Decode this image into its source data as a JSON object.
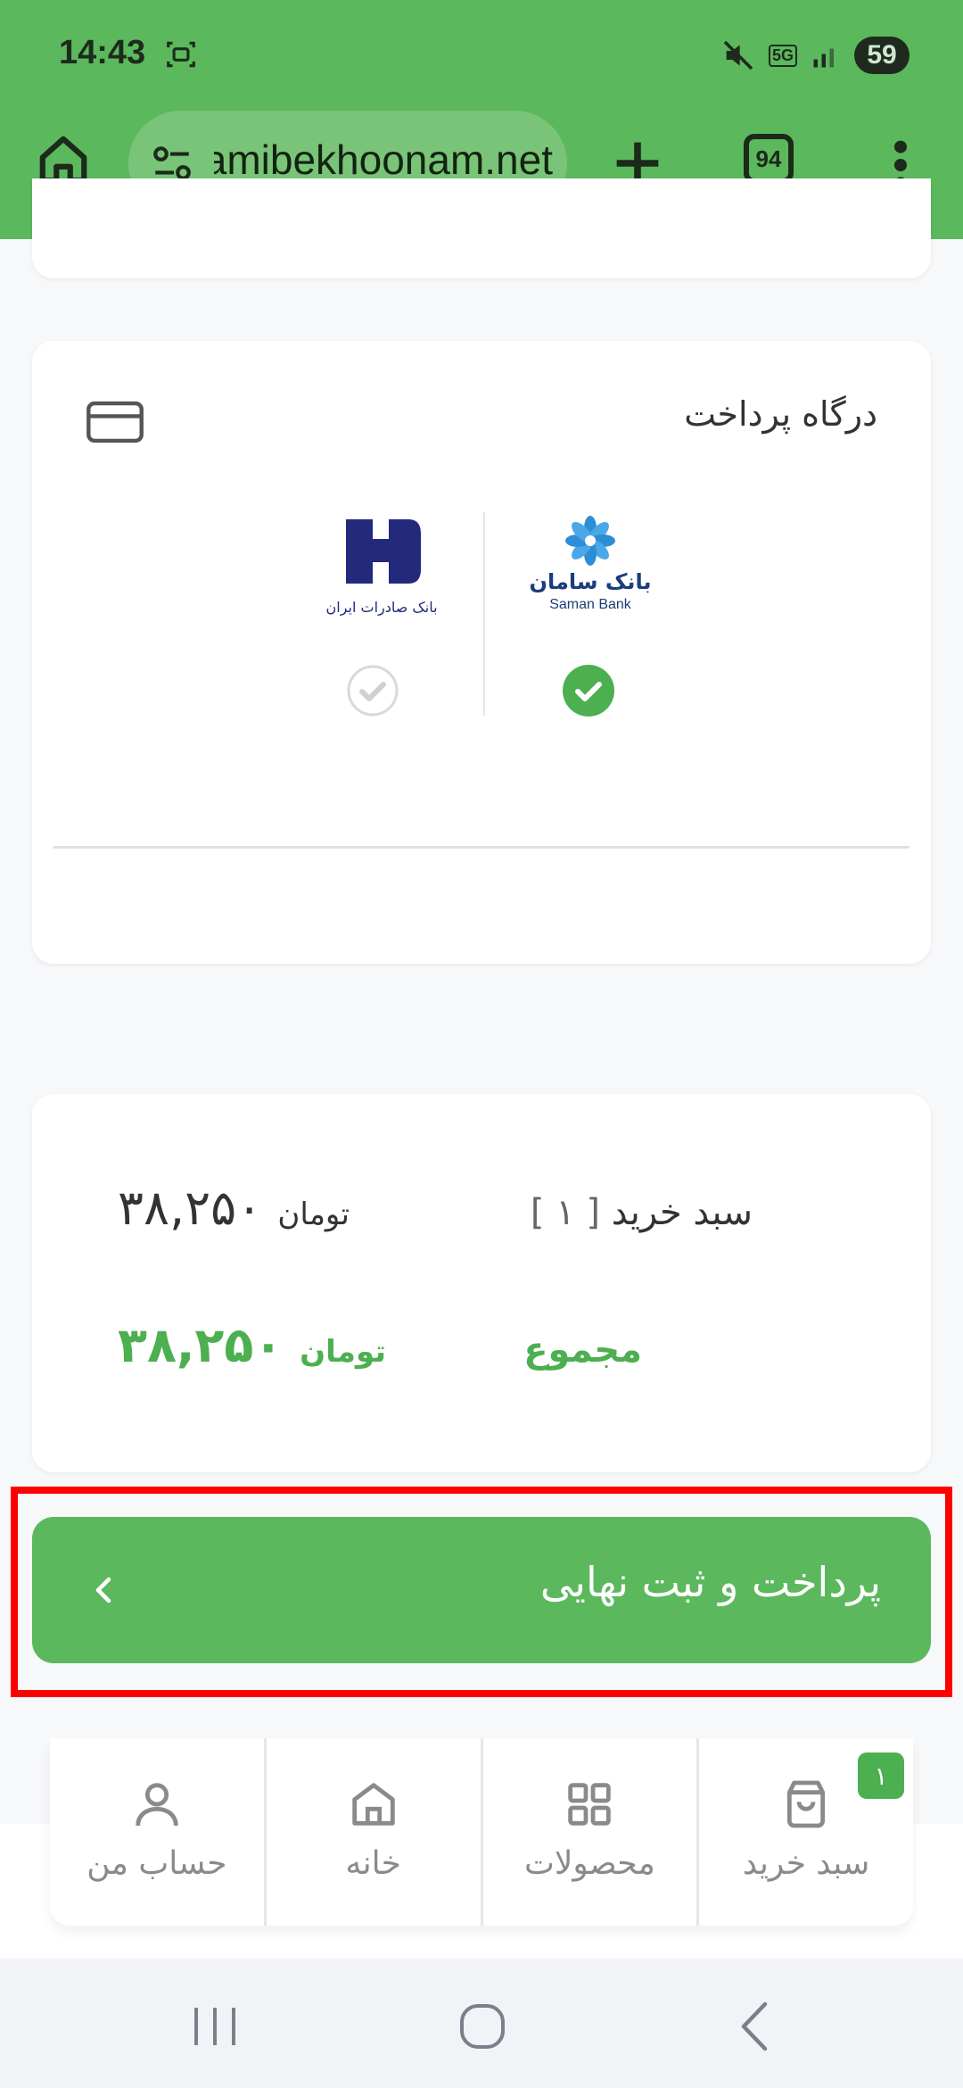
{
  "status_bar": {
    "time": "14:43",
    "network_label": "5G",
    "battery": "59"
  },
  "browser": {
    "url": "hamibekhoonam.net",
    "tab_count": "94"
  },
  "payment_gateway": {
    "title": "درگاه پرداخت",
    "options": [
      {
        "bank_name": "بانک سامان",
        "bank_name_en": "Saman Bank",
        "selected": true
      },
      {
        "bank_name": "بانک صادرات ایران",
        "selected": false
      }
    ]
  },
  "summary": {
    "cart_label": "سبد خرید",
    "cart_count": "[ ۱ ]",
    "cart_amount": "۳۸,۲۵۰",
    "total_label": "مجموع",
    "total_amount": "۳۸,۲۵۰",
    "currency": "تومان"
  },
  "pay_button": {
    "label": "پرداخت و ثبت نهایی"
  },
  "bottom_nav": {
    "items": [
      {
        "label": "حساب من",
        "icon": "user-icon"
      },
      {
        "label": "خانه",
        "icon": "home-icon"
      },
      {
        "label": "محصولات",
        "icon": "grid-icon"
      },
      {
        "label": "سبد خرید",
        "icon": "shopping-bag-icon",
        "badge": "۱"
      }
    ]
  },
  "colors": {
    "brand_green": "#5cb85c",
    "highlight": "#ff0000"
  }
}
